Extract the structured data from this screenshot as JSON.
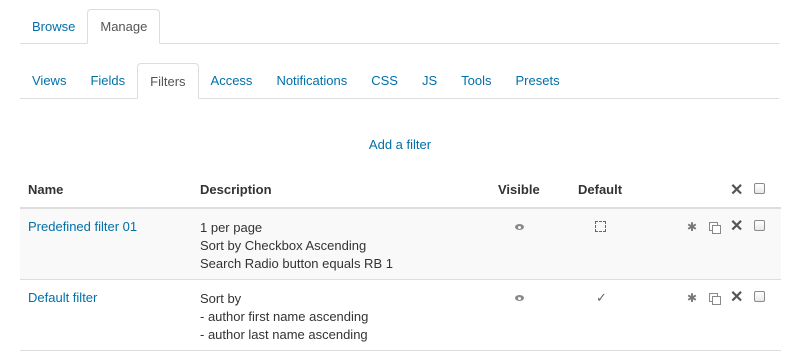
{
  "top_tabs": [
    {
      "label": "Browse",
      "active": false
    },
    {
      "label": "Manage",
      "active": true
    }
  ],
  "sub_tabs": [
    {
      "label": "Views",
      "active": false
    },
    {
      "label": "Fields",
      "active": false
    },
    {
      "label": "Filters",
      "active": true
    },
    {
      "label": "Access",
      "active": false
    },
    {
      "label": "Notifications",
      "active": false
    },
    {
      "label": "CSS",
      "active": false
    },
    {
      "label": "JS",
      "active": false
    },
    {
      "label": "Tools",
      "active": false
    },
    {
      "label": "Presets",
      "active": false
    }
  ],
  "add_filter_label": "Add a filter",
  "table": {
    "headers": {
      "name": "Name",
      "description": "Description",
      "visible": "Visible",
      "default": "Default"
    },
    "rows": [
      {
        "name": "Predefined filter 01",
        "description": [
          "1 per page",
          "Sort by Checkbox Ascending",
          "Search Radio button equals RB 1"
        ],
        "visible_icon": "eye-icon",
        "default_icon": "dashed-square-icon"
      },
      {
        "name": "Default filter",
        "description": [
          "Sort by",
          "- author first name ascending",
          "- author last name ascending"
        ],
        "visible_icon": "eye-icon",
        "default_icon": "checkmark-icon"
      }
    ]
  },
  "colors": {
    "link": "#0070a8",
    "text": "#333333",
    "border": "#dddddd",
    "stripe": "#f9f9f9"
  }
}
